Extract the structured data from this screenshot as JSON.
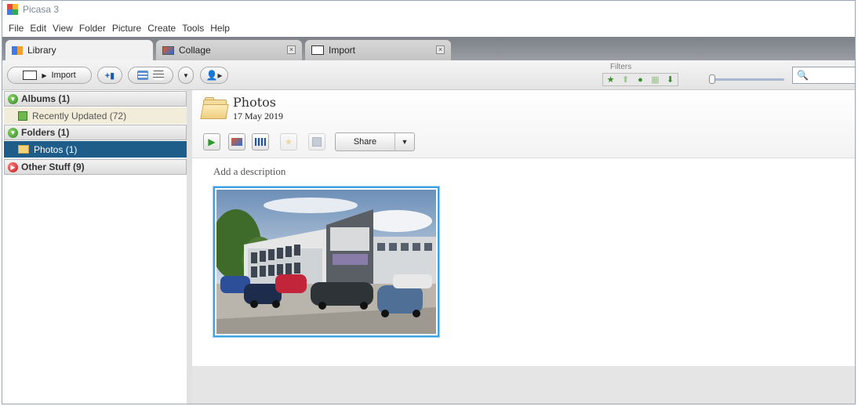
{
  "app": {
    "title": "Picasa 3",
    "menu": [
      "File",
      "Edit",
      "View",
      "Folder",
      "Picture",
      "Create",
      "Tools",
      "Help"
    ]
  },
  "tabs": [
    {
      "label": "Library",
      "icon": "library-icon",
      "active": true
    },
    {
      "label": "Collage",
      "icon": "collage-icon",
      "active": false
    },
    {
      "label": "Import",
      "icon": "import-icon",
      "active": false
    }
  ],
  "toolbar": {
    "import_label": "Import",
    "filters_label": "Filters",
    "search_placeholder": ""
  },
  "sidebar": {
    "albums": {
      "label": "Albums (1)",
      "items": [
        {
          "label": "Recently Updated (72)",
          "icon": "album-icon"
        }
      ]
    },
    "folders": {
      "label": "Folders (1)",
      "items": [
        {
          "label": "Photos (1)",
          "icon": "folder-icon"
        }
      ]
    },
    "other": {
      "label": "Other Stuff (9)"
    }
  },
  "folder": {
    "title": "Photos",
    "date": "17 May 2019",
    "description_placeholder": "Add a description",
    "share_label": "Share"
  },
  "colors": {
    "selected_row": "#1e5d8a",
    "thumb_border": "#3ea2e0",
    "tab_strip": "#8b8f95"
  }
}
